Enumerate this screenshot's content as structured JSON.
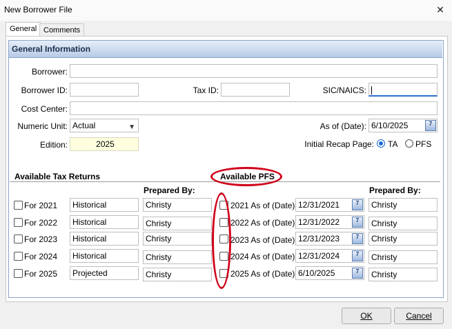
{
  "window": {
    "title": "New Borrower File",
    "close_glyph": "✕"
  },
  "tabs": [
    {
      "label": "General"
    },
    {
      "label": "Comments"
    }
  ],
  "section": {
    "title": "General Information"
  },
  "form": {
    "borrower_label": "Borrower:",
    "borrower_value": "",
    "borrower_id_label": "Borrower ID:",
    "borrower_id_value": "",
    "tax_id_label": "Tax ID:",
    "tax_id_value": "",
    "sic_label": "SIC/NAICS:",
    "sic_value": "",
    "cost_center_label": "Cost Center:",
    "cost_center_value": "",
    "numeric_unit_label": "Numeric Unit:",
    "numeric_unit_value": "Actual",
    "as_of_label": "As of (Date):",
    "as_of_value": "6/10/2025",
    "edition_label": "Edition:",
    "edition_value": "2025",
    "recap_label": "Initial Recap Page:",
    "recap_ta": "TA",
    "recap_pfs": "PFS",
    "recap_selected": "TA"
  },
  "tax_returns": {
    "title": "Available Tax Returns",
    "prepared_by_header": "Prepared By:",
    "rows": [
      {
        "label": "For 2021",
        "type": "Historical",
        "prepared_by": "Christy"
      },
      {
        "label": "For 2022",
        "type": "Historical",
        "prepared_by": "Christy"
      },
      {
        "label": "For 2023",
        "type": "Historical",
        "prepared_by": "Christy"
      },
      {
        "label": "For 2024",
        "type": "Historical",
        "prepared_by": "Christy"
      },
      {
        "label": "For 2025",
        "type": "Projected",
        "prepared_by": "Christy"
      }
    ]
  },
  "pfs": {
    "title": "Available PFS",
    "prepared_by_header": "Prepared By:",
    "rows": [
      {
        "label": "2021 As of (Date):",
        "date": "12/31/2021",
        "prepared_by": "Christy"
      },
      {
        "label": "2022 As of (Date):",
        "date": "12/31/2022",
        "prepared_by": "Christy"
      },
      {
        "label": "2023 As of (Date):",
        "date": "12/31/2023",
        "prepared_by": "Christy"
      },
      {
        "label": "2024 As of (Date):",
        "date": "12/31/2024",
        "prepared_by": "Christy"
      },
      {
        "label": "2025 As of (Date):",
        "date": "6/10/2025",
        "prepared_by": "Christy"
      }
    ]
  },
  "calendar_icon_text": "7",
  "buttons": {
    "ok": "OK",
    "cancel": "Cancel"
  },
  "colors": {
    "annotation": "#d0021b",
    "header_gradient_top": "#e6eef9",
    "header_gradient_bottom": "#b7cae6",
    "accent": "#1a6ad6"
  }
}
